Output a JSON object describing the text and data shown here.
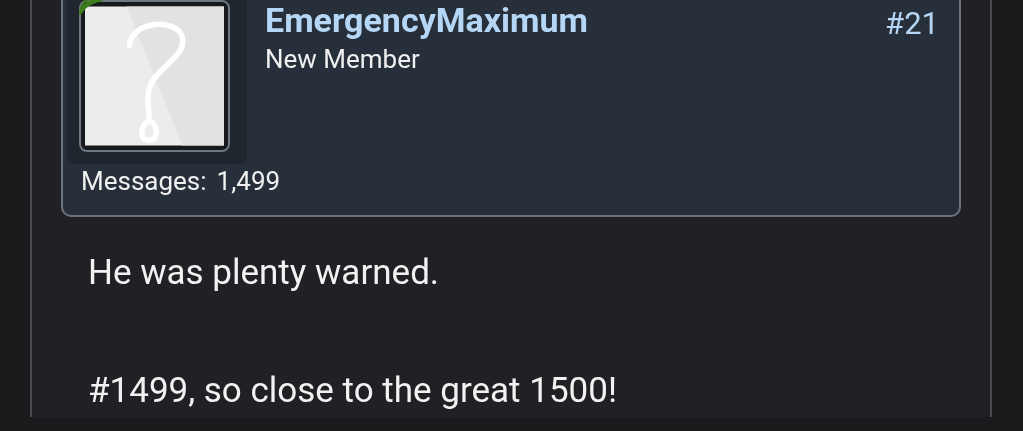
{
  "post": {
    "author": {
      "name": "EmergencyMaximum",
      "role": "New Member",
      "online": true,
      "messages_label": "Messages:",
      "messages_count": "1,499"
    },
    "number": "#21",
    "paragraphs": [
      "He was plenty warned.",
      "#1499, so close to the great 1500!"
    ]
  }
}
